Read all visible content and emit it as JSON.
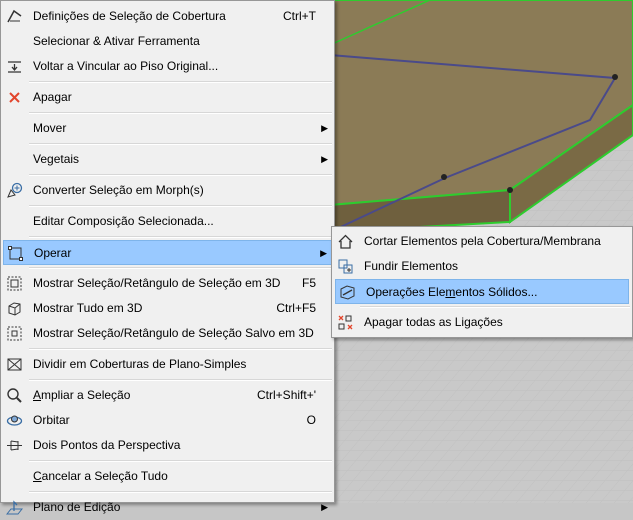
{
  "main_menu": {
    "items": [
      {
        "label": "Definições de Seleção de Cobertura",
        "shortcut": "Ctrl+T"
      },
      {
        "label": "Selecionar & Ativar Ferramenta",
        "shortcut": ""
      },
      {
        "label": "Voltar a Vincular ao Piso Original...",
        "shortcut": ""
      },
      {
        "label": "Apagar",
        "shortcut": ""
      },
      {
        "label": "Mover",
        "shortcut": ""
      },
      {
        "label": "Vegetais",
        "shortcut": ""
      },
      {
        "label": "Converter Seleção em Morph(s)",
        "shortcut": ""
      },
      {
        "label": "Editar Composição Selecionada...",
        "shortcut": ""
      },
      {
        "label": "Operar",
        "shortcut": ""
      },
      {
        "label": "Mostrar Seleção/Retângulo de Seleção em 3D",
        "shortcut": "F5"
      },
      {
        "label": "Mostrar Tudo em 3D",
        "shortcut": "Ctrl+F5"
      },
      {
        "label": "Mostrar Seleção/Retângulo de Seleção Salvo em 3D",
        "shortcut": ""
      },
      {
        "label": "Dividir em Coberturas de Plano-Simples",
        "shortcut": ""
      },
      {
        "label_pre": "",
        "label_u": "A",
        "label_post": "mpliar a Seleção",
        "shortcut": "Ctrl+Shift+'"
      },
      {
        "label": "Orbitar",
        "shortcut": "O"
      },
      {
        "label": "Dois Pontos da Perspectiva",
        "shortcut": ""
      },
      {
        "label_pre": "",
        "label_u": "C",
        "label_post": "ancelar a Seleção Tudo",
        "shortcut": ""
      },
      {
        "label": "Plano de Edição",
        "shortcut": ""
      }
    ]
  },
  "sub_menu": {
    "items": [
      {
        "label": "Cortar Elementos pela Cobertura/Membrana"
      },
      {
        "label": "Fundir Elementos"
      },
      {
        "label_pre": "Operações Ele",
        "label_u": "m",
        "label_post": "entos Sólidos..."
      },
      {
        "label": "Apagar todas as Ligações"
      }
    ]
  },
  "colors": {
    "roof_fill": "#8a7a55",
    "roof_edge": "#2ecc2e",
    "ridge_line": "#4a4a8a",
    "highlight": "#99c9ff",
    "delete_icon": "#e2452c"
  }
}
